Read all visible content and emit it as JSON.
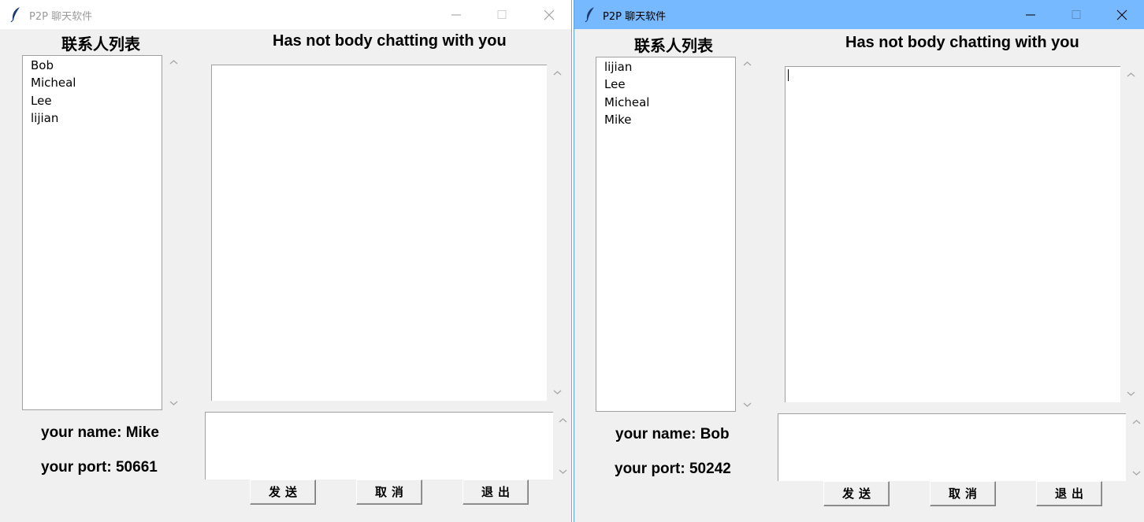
{
  "windows": [
    {
      "title": "P2P 聊天软件",
      "contacts_heading": "联系人列表",
      "contacts": [
        "Bob",
        "Micheal",
        "Lee",
        "lijian"
      ],
      "chat_heading": "Has not body chatting with you",
      "name_label": "your name: Mike",
      "port_label": "your port: 50661",
      "buttons": {
        "send": "发送",
        "cancel": "取消",
        "exit": "退出"
      },
      "active": false
    },
    {
      "title": "P2P 聊天软件",
      "contacts_heading": "联系人列表",
      "contacts": [
        "lijian",
        "Lee",
        "Micheal",
        "Mike"
      ],
      "chat_heading": "Has not body chatting with you",
      "name_label": "your name: Bob",
      "port_label": "your port: 50242",
      "buttons": {
        "send": "发送",
        "cancel": "取消",
        "exit": "退出"
      },
      "active": true
    }
  ],
  "colors": {
    "active_titlebar": "#76b9ff",
    "inactive_titlebar": "#ffffff",
    "window_bg": "#f0f0f0"
  },
  "icons": {
    "app": "feather-icon",
    "minimize": "minimize-icon",
    "maximize": "maximize-icon",
    "close": "close-icon",
    "scroll_up": "chevron-up-icon",
    "scroll_down": "chevron-down-icon"
  }
}
